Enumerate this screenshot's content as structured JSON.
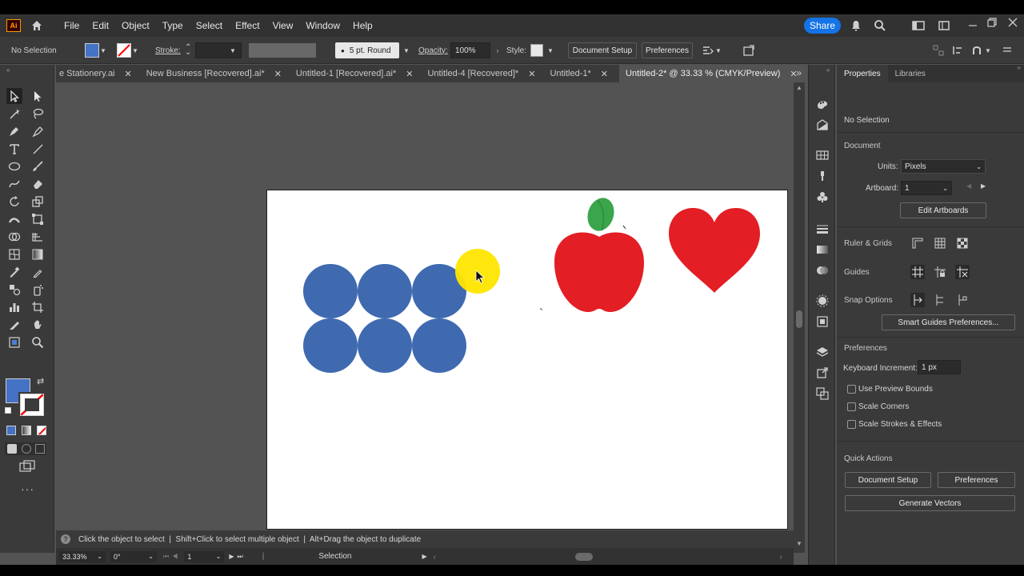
{
  "app": {
    "logo_text": "Ai"
  },
  "menubar": {
    "items": [
      "File",
      "Edit",
      "Object",
      "Type",
      "Select",
      "Effect",
      "View",
      "Window",
      "Help"
    ],
    "share_label": "Share"
  },
  "control": {
    "selection_label": "No Selection",
    "stroke_label": "Stroke:",
    "brush_label": "5 pt. Round",
    "opacity_label": "Opacity:",
    "opacity_value": "100%",
    "style_label": "Style:",
    "document_setup": "Document Setup",
    "preferences": "Preferences",
    "fill_color": "#4472c4",
    "stroke_color": "#ff0000"
  },
  "tabs": [
    {
      "label": "e Stationery.ai"
    },
    {
      "label": "New Business [Recovered].ai*"
    },
    {
      "label": "Untitled-1 [Recovered].ai*"
    },
    {
      "label": "Untitled-4 [Recovered]*"
    },
    {
      "label": "Untitled-1*"
    },
    {
      "label": "Untitled-2* @ 33.33 % (CMYK/Preview)",
      "active": true
    }
  ],
  "tabs_overflow": "»",
  "artwork": {
    "circle_color": "#3f6ab0",
    "highlight_color": "#ffe600",
    "apple_color": "#e31e24",
    "leaf_color": "#3aa54a",
    "heart_color": "#e31e24"
  },
  "properties": {
    "tabs": [
      "Properties",
      "Libraries"
    ],
    "selection": "No Selection",
    "document_title": "Document",
    "units_label": "Units:",
    "units_value": "Pixels",
    "artboard_label": "Artboard:",
    "artboard_value": "1",
    "edit_artboards": "Edit Artboards",
    "ruler_grids": "Ruler & Grids",
    "guides": "Guides",
    "snap_options": "Snap Options",
    "smart_guides_prefs": "Smart Guides Preferences...",
    "preferences_title": "Preferences",
    "keyboard_increment_label": "Keyboard Increment:",
    "keyboard_increment_value": "1 px",
    "use_preview_bounds": "Use Preview Bounds",
    "scale_corners": "Scale Corners",
    "scale_strokes_effects": "Scale Strokes & Effects",
    "quick_actions": "Quick Actions",
    "qa_document_setup": "Document Setup",
    "qa_preferences": "Preferences",
    "generate_vectors": "Generate Vectors"
  },
  "hint": {
    "text": "Click the object to select  |  Shift+Click to select multiple object  |  Alt+Drag the object to duplicate"
  },
  "status": {
    "zoom": "33.33%",
    "rotation": "0°",
    "artboard": "1",
    "tool": "Selection"
  }
}
